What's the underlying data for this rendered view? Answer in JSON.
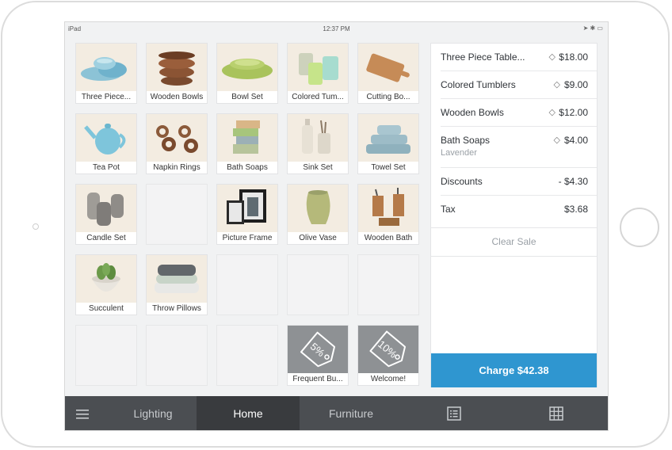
{
  "status": {
    "device": "iPad",
    "time": "12:37 PM",
    "right": "➤ ✱ ▭"
  },
  "tiles": [
    {
      "label": "Three Piece..."
    },
    {
      "label": "Wooden Bowls"
    },
    {
      "label": "Bowl Set"
    },
    {
      "label": "Colored Tum..."
    },
    {
      "label": "Cutting Bo..."
    },
    {
      "label": "Tea Pot"
    },
    {
      "label": "Napkin Rings"
    },
    {
      "label": "Bath Soaps"
    },
    {
      "label": "Sink Set"
    },
    {
      "label": "Towel Set"
    },
    {
      "label": "Candle Set"
    },
    {
      "label": ""
    },
    {
      "label": "Picture Frame"
    },
    {
      "label": "Olive Vase"
    },
    {
      "label": "Wooden Bath"
    },
    {
      "label": "Succulent"
    },
    {
      "label": "Throw Pillows"
    },
    {
      "label": "Frequent Bu..."
    },
    {
      "label": "Welcome!"
    }
  ],
  "discount_badges": {
    "frequent": "5%",
    "welcome": "10%"
  },
  "cart": {
    "items": [
      {
        "name": "Three Piece Table...",
        "price": "$18.00"
      },
      {
        "name": "Colored Tumblers",
        "price": "$9.00"
      },
      {
        "name": "Wooden Bowls",
        "price": "$12.00"
      },
      {
        "name": "Bath Soaps",
        "sub": "Lavender",
        "price": "$4.00"
      }
    ],
    "discounts_label": "Discounts",
    "discounts_value": "- $4.30",
    "tax_label": "Tax",
    "tax_value": "$3.68",
    "clear_label": "Clear Sale",
    "charge_label": "Charge $42.38"
  },
  "nav": {
    "lighting": "Lighting",
    "home": "Home",
    "furniture": "Furniture"
  },
  "icons": {
    "menu": "hamburger-icon",
    "list": "list-icon",
    "grid": "grid-icon",
    "tag": "tag-icon"
  },
  "colors": {
    "charge": "#2f96d0",
    "nav": "#4b4e52",
    "nav_active": "#393b3e"
  }
}
